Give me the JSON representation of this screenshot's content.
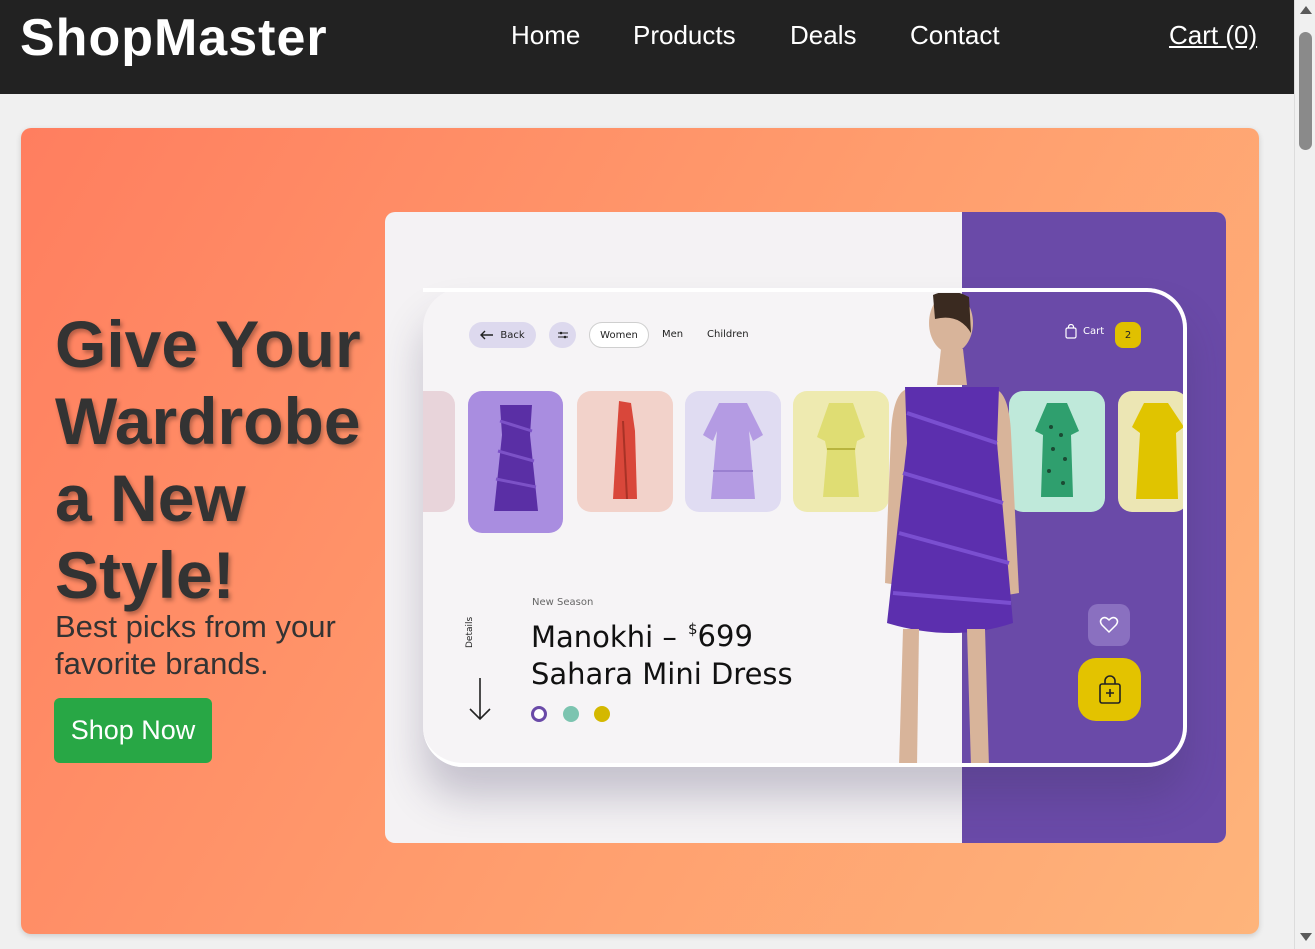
{
  "header": {
    "logo": "ShopMaster",
    "nav": [
      {
        "label": "Home"
      },
      {
        "label": "Products"
      },
      {
        "label": "Deals"
      },
      {
        "label": "Contact"
      }
    ],
    "cart_label": "Cart (0)"
  },
  "hero": {
    "title": "Give Your Wardrobe a New Style!",
    "subtitle": "Best picks from your favorite brands.",
    "cta_label": "Shop Now",
    "gradient_colors": [
      "#ff7e5f",
      "#feb47b"
    ],
    "cta_color": "#28a745"
  },
  "mockup": {
    "back_label": "Back",
    "tabs": [
      "Women",
      "Men",
      "Children"
    ],
    "cart_label": "Cart",
    "cart_count": "2",
    "season_label": "New Season",
    "product_line1": "Manokhi –",
    "product_line2": "Sahara Mini Dress",
    "price_currency": "$",
    "price_value": "699",
    "details_label": "Details",
    "accent_purple": "#6a4aa8",
    "swatches": [
      "#6a4aa8",
      "#7cc4b0",
      "#d4b800"
    ]
  }
}
